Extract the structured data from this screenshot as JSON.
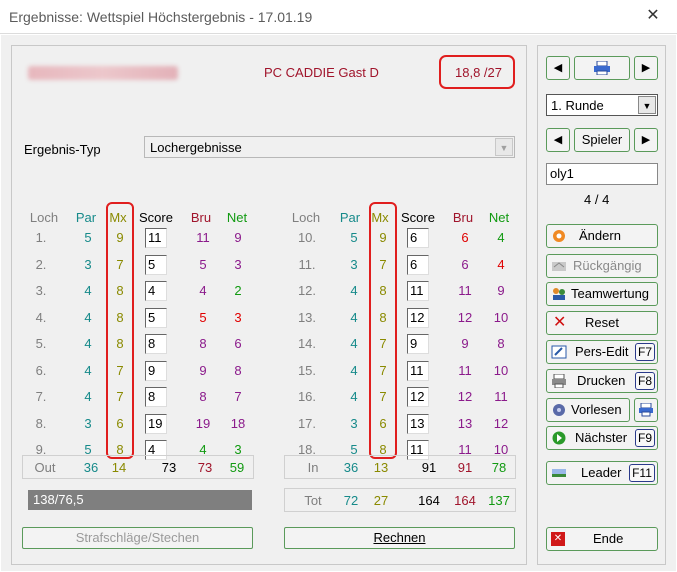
{
  "window": {
    "title": "Ergebnisse: Wettspiel Höchstergebnis - 17.01.19",
    "close_icon": "close-icon"
  },
  "header": {
    "player_name": "PC CADDIE Gast D",
    "handicap": "18,8 /27"
  },
  "result_type": {
    "label": "Ergebnis-Typ",
    "value": "Lochergebnisse"
  },
  "columns": {
    "loch": "Loch",
    "par": "Par",
    "mx": "Mx",
    "score": "Score",
    "bru": "Bru",
    "net": "Net"
  },
  "front_nine": [
    {
      "hole": "1.",
      "par": "5",
      "mx": "9",
      "score": "11",
      "bru": "11",
      "net": "9",
      "bru_color": "#8b1a8b",
      "net_color": "#8b1a8b"
    },
    {
      "hole": "2.",
      "par": "3",
      "mx": "7",
      "score": "5",
      "bru": "5",
      "net": "3",
      "bru_color": "#8b1a8b",
      "net_color": "#8b1a8b"
    },
    {
      "hole": "3.",
      "par": "4",
      "mx": "8",
      "score": "4",
      "bru": "4",
      "net": "2",
      "bru_color": "#8b1a8b",
      "net_color": "#119a11"
    },
    {
      "hole": "4.",
      "par": "4",
      "mx": "8",
      "score": "5",
      "bru": "5",
      "net": "3",
      "bru_color": "#e00000",
      "net_color": "#e00000"
    },
    {
      "hole": "5.",
      "par": "4",
      "mx": "8",
      "score": "8",
      "bru": "8",
      "net": "6",
      "bru_color": "#8b1a8b",
      "net_color": "#8b1a8b"
    },
    {
      "hole": "6.",
      "par": "4",
      "mx": "7",
      "score": "9",
      "bru": "9",
      "net": "8",
      "bru_color": "#8b1a8b",
      "net_color": "#8b1a8b"
    },
    {
      "hole": "7.",
      "par": "4",
      "mx": "7",
      "score": "8",
      "bru": "8",
      "net": "7",
      "bru_color": "#8b1a8b",
      "net_color": "#8b1a8b"
    },
    {
      "hole": "8.",
      "par": "3",
      "mx": "6",
      "score": "19",
      "bru": "19",
      "net": "18",
      "bru_color": "#8b1a8b",
      "net_color": "#8b1a8b"
    },
    {
      "hole": "9.",
      "par": "5",
      "mx": "8",
      "score": "4",
      "bru": "4",
      "net": "3",
      "bru_color": "#119a11",
      "net_color": "#119a11"
    }
  ],
  "back_nine": [
    {
      "hole": "10.",
      "par": "5",
      "mx": "9",
      "score": "6",
      "bru": "6",
      "net": "4",
      "bru_color": "#e00000",
      "net_color": "#119a11"
    },
    {
      "hole": "11.",
      "par": "3",
      "mx": "7",
      "score": "6",
      "bru": "6",
      "net": "4",
      "bru_color": "#8b1a8b",
      "net_color": "#e00000"
    },
    {
      "hole": "12.",
      "par": "4",
      "mx": "8",
      "score": "11",
      "bru": "11",
      "net": "9",
      "bru_color": "#8b1a8b",
      "net_color": "#8b1a8b"
    },
    {
      "hole": "13.",
      "par": "4",
      "mx": "8",
      "score": "12",
      "bru": "12",
      "net": "10",
      "bru_color": "#8b1a8b",
      "net_color": "#8b1a8b"
    },
    {
      "hole": "14.",
      "par": "4",
      "mx": "7",
      "score": "9",
      "bru": "9",
      "net": "8",
      "bru_color": "#8b1a8b",
      "net_color": "#8b1a8b"
    },
    {
      "hole": "15.",
      "par": "4",
      "mx": "7",
      "score": "11",
      "bru": "11",
      "net": "10",
      "bru_color": "#8b1a8b",
      "net_color": "#8b1a8b"
    },
    {
      "hole": "16.",
      "par": "4",
      "mx": "7",
      "score": "12",
      "bru": "12",
      "net": "11",
      "bru_color": "#8b1a8b",
      "net_color": "#8b1a8b"
    },
    {
      "hole": "17.",
      "par": "3",
      "mx": "6",
      "score": "13",
      "bru": "13",
      "net": "12",
      "bru_color": "#8b1a8b",
      "net_color": "#8b1a8b"
    },
    {
      "hole": "18.",
      "par": "5",
      "mx": "8",
      "score": "11",
      "bru": "11",
      "net": "10",
      "bru_color": "#8b1a8b",
      "net_color": "#8b1a8b"
    }
  ],
  "totals": {
    "out": {
      "label": "Out",
      "par": "36",
      "mx": "14",
      "score": "73",
      "bru": "73",
      "net": "59"
    },
    "in": {
      "label": "In",
      "par": "36",
      "mx": "13",
      "score": "91",
      "bru": "91",
      "net": "78"
    },
    "tot": {
      "label": "Tot",
      "par": "72",
      "mx": "27",
      "score": "164",
      "bru": "164",
      "net": "137"
    }
  },
  "handicap_result": "138/76,5",
  "buttons": {
    "strafschlaege": "Strafschläge/Stechen",
    "rechnen": "Rechnen"
  },
  "sidebar": {
    "round_value": "1. Runde",
    "spieler_label": "Spieler",
    "player_field": "oly1",
    "counter": "4 / 4",
    "aendern": "Ändern",
    "rueckgaengig": "Rückgängig",
    "teamwertung": "Teamwertung",
    "reset": "Reset",
    "pers_edit": "Pers-Edit",
    "pers_edit_key": "F7",
    "drucken": "Drucken",
    "drucken_key": "F8",
    "vorlesen": "Vorlesen",
    "naechster": "Nächster",
    "naechster_key": "F9",
    "leader": "Leader",
    "leader_key": "F11",
    "ende": "Ende"
  },
  "colors": {
    "accent_red": "#e01e1e",
    "player_red": "#a0142b",
    "par_teal": "#168a8a",
    "mx_olive": "#8a8a00",
    "bru_purple": "#8b1a8b",
    "net_green": "#119a11"
  }
}
